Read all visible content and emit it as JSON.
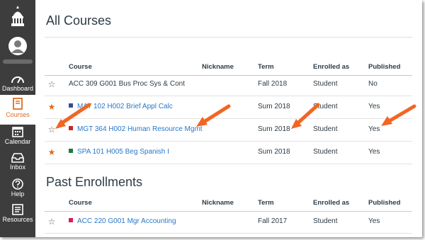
{
  "colors": {
    "sidebar": "#3d3d3d",
    "accent": "#e06b1f",
    "link": "#2878c8",
    "arrow": "#f26522"
  },
  "sidebar": {
    "items": [
      {
        "label": "Dashboard",
        "icon": "dashboard-icon"
      },
      {
        "label": "Courses",
        "icon": "book-icon",
        "active": true
      },
      {
        "label": "Calendar",
        "icon": "calendar-icon"
      },
      {
        "label": "Inbox",
        "icon": "inbox-icon"
      },
      {
        "label": "Help",
        "icon": "help-icon"
      },
      {
        "label": "Resources",
        "icon": "resources-icon"
      }
    ]
  },
  "all_courses": {
    "title": "All Courses",
    "columns": [
      "Course",
      "Nickname",
      "Term",
      "Enrolled as",
      "Published"
    ],
    "rows": [
      {
        "favorite": false,
        "color": "",
        "course": "ACC 309 G001 Bus Proc Sys & Cont",
        "nickname": "",
        "term": "Fall 2018",
        "enrolled": "Student",
        "published": "No",
        "link": false
      },
      {
        "favorite": true,
        "color": "#3b4b8c",
        "course": "MAT 102 H002 Brief Appl Calc",
        "nickname": "",
        "term": "Sum 2018",
        "enrolled": "Student",
        "published": "Yes",
        "link": true
      },
      {
        "favorite": false,
        "color": "#c62828",
        "course": "MGT 364 H002 Human Resource Mgmt",
        "nickname": "",
        "term": "Sum 2018",
        "enrolled": "Student",
        "published": "Yes",
        "link": true
      },
      {
        "favorite": true,
        "color": "#1b7a4a",
        "course": "SPA 101 H005 Beg Spanish I",
        "nickname": "",
        "term": "Sum 2018",
        "enrolled": "Student",
        "published": "Yes",
        "link": true
      }
    ]
  },
  "past_enrollments": {
    "title": "Past Enrollments",
    "columns": [
      "Course",
      "Nickname",
      "Term",
      "Enrolled as",
      "Published"
    ],
    "rows": [
      {
        "favorite": false,
        "color": "#d81b60",
        "course": "ACC 220 G001 Mgr Accounting",
        "nickname": "",
        "term": "Fall 2017",
        "enrolled": "Student",
        "published": "Yes",
        "link": true
      }
    ]
  },
  "glyphs": {
    "star_filled": "★",
    "star_empty": "☆"
  }
}
